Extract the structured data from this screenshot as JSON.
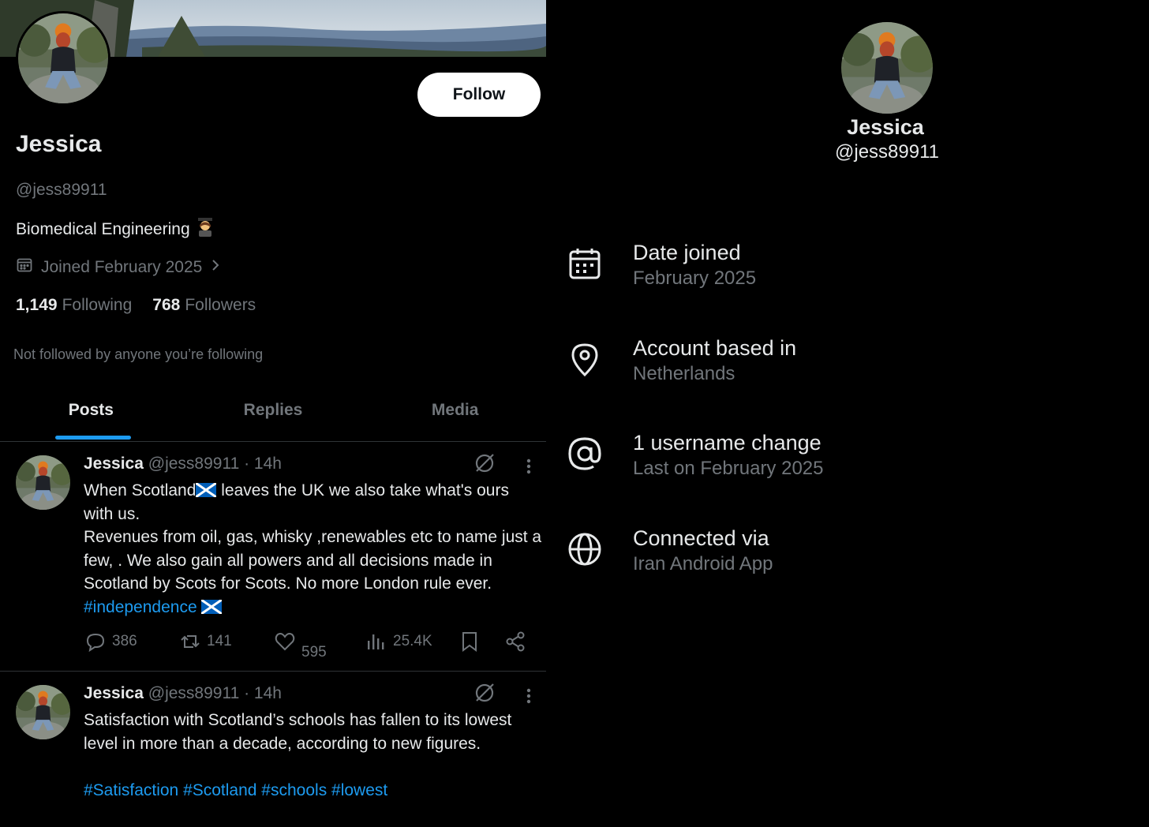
{
  "profile": {
    "name": "Jessica",
    "handle": "@jess89911",
    "bio": "Biomedical Engineering",
    "bio_emoji": "student-emoji",
    "joined": "Joined February 2025",
    "following_count": "1,149",
    "following_label": "Following",
    "followers_count": "768",
    "followers_label": "Followers",
    "not_followed": "Not followed by anyone you’re following",
    "follow_button": "Follow"
  },
  "tabs": [
    {
      "label": "Posts",
      "active": true
    },
    {
      "label": "Replies",
      "active": false
    },
    {
      "label": "Media",
      "active": false
    }
  ],
  "posts": [
    {
      "name": "Jessica",
      "handle": "@jess89911",
      "time": "· 14h",
      "text_1": "When Scotland",
      "text_2": " leaves the UK we also take what's ours with us.",
      "text_3": "Revenues from oil, gas, whisky ,renewables etc to name just a few, . We also gain all powers and all decisions made in Scotland by Scots for Scots. No more London rule ever.",
      "hashtag": "#independence",
      "replies": "386",
      "reposts": "141",
      "likes": "595",
      "views": "25.4K"
    },
    {
      "name": "Jessica",
      "handle": "@jess89911",
      "time": "· 14h",
      "text_1": "Satisfaction with Scotland’s schools has fallen to its lowest level in more than a decade, according to new figures.",
      "hashtags": "#Satisfaction #Scotland #schools #lowest"
    }
  ],
  "about": {
    "name": "Jessica",
    "handle": "@jess89911",
    "rows": [
      {
        "icon": "calendar-icon",
        "title": "Date joined",
        "value": "February 2025"
      },
      {
        "icon": "location-pin-icon",
        "title": "Account based in",
        "value": "Netherlands"
      },
      {
        "icon": "at-sign-icon",
        "title": "1 username change",
        "value": "Last on February 2025"
      },
      {
        "icon": "globe-icon",
        "title": "Connected via",
        "value": "Iran Android App"
      }
    ]
  },
  "colors": {
    "background": "#000000",
    "text": "#e7e9ea",
    "muted": "#71767b",
    "accent": "#1d9bf0",
    "divider": "#2f3336"
  }
}
